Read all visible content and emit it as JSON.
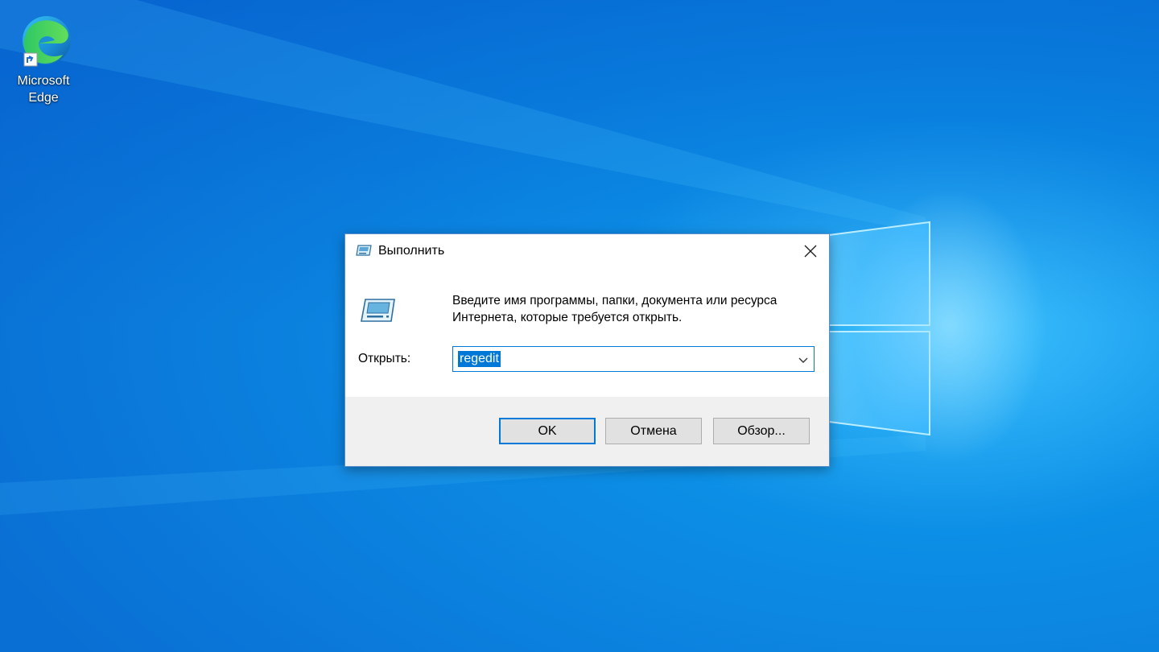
{
  "desktop": {
    "icons": [
      {
        "label": "Microsoft Edge",
        "icon": "edge-icon"
      }
    ],
    "colors": {
      "wallpaper_dark": "#0050c8",
      "wallpaper_light": "#3fc3ff",
      "accent": "#0078d7"
    }
  },
  "dialog": {
    "title": "Выполнить",
    "close_icon": "close-icon",
    "app_icon": "run-icon",
    "description_line1": "Введите имя программы, папки, документа или ресурса",
    "description_line2": "Интернета, которые требуется открыть.",
    "open_label": "Открыть:",
    "combo_value": "regedit",
    "buttons": {
      "ok": "OK",
      "cancel": "Отмена",
      "browse": "Обзор..."
    }
  }
}
